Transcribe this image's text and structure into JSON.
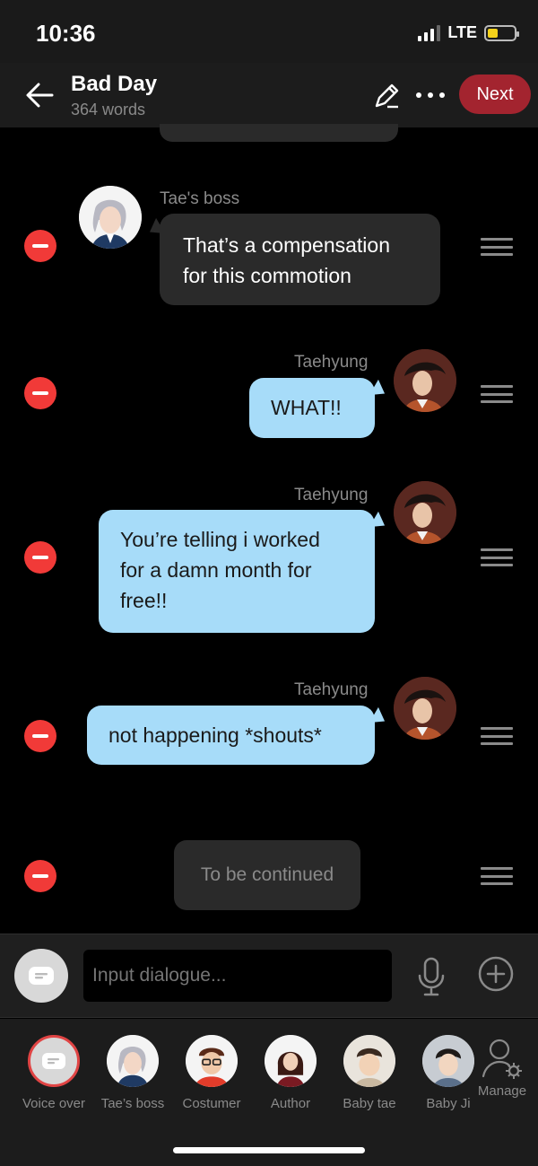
{
  "status_bar": {
    "time": "10:36",
    "network": "LTE"
  },
  "header": {
    "title": "Bad Day",
    "word_count": "364 words",
    "next_label": "Next"
  },
  "messages": [
    {
      "speaker": "Tae's boss",
      "text_lines": [
        "That’s a compensation",
        "for this commotion"
      ],
      "side": "left"
    },
    {
      "speaker": "Taehyung",
      "text_lines": [
        "WHAT!!"
      ],
      "side": "right"
    },
    {
      "speaker": "Taehyung",
      "text_lines": [
        "You’re telling i worked",
        "for a damn month for",
        "free!!"
      ],
      "side": "right"
    },
    {
      "speaker": "Taehyung",
      "text_lines": [
        "not happening *shouts*"
      ],
      "side": "right"
    },
    {
      "speaker": "",
      "text_lines": [
        "To be continued"
      ],
      "side": "narration"
    }
  ],
  "input": {
    "placeholder": "Input dialogue..."
  },
  "characters": [
    {
      "label": "Voice over"
    },
    {
      "label": "Tae’s boss"
    },
    {
      "label": "Costumer"
    },
    {
      "label": "Author"
    },
    {
      "label": "Baby tae"
    },
    {
      "label": "Baby Ji"
    },
    {
      "label": "Manage"
    }
  ],
  "colors": {
    "accent": "#a3242f",
    "delete": "#f13a38",
    "bubble_blue": "#a7dcf9",
    "bubble_dark": "#2a2a2a"
  }
}
